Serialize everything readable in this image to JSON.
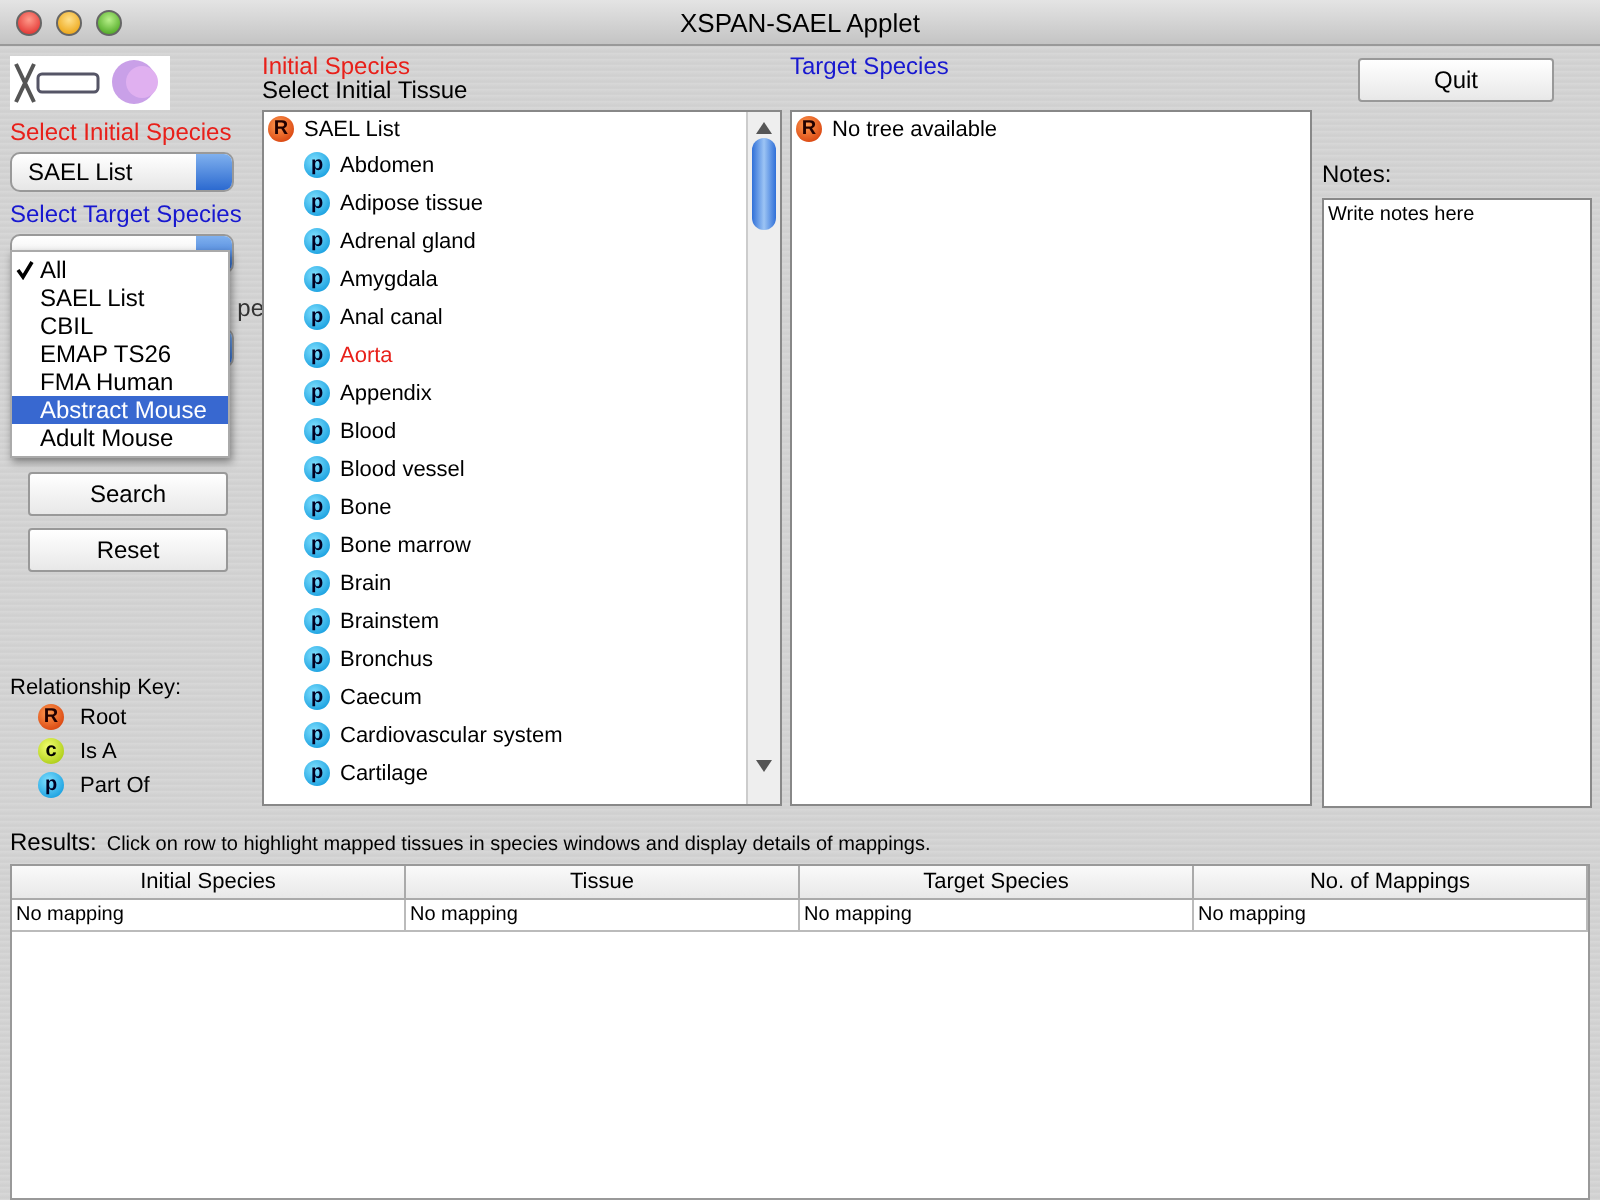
{
  "window": {
    "title": "XSPAN-SAEL Applet"
  },
  "left_panel": {
    "initial_label": "Select Initial Species",
    "initial_value": "SAEL List",
    "target_label": "Select Target Species",
    "mapping_label_fragment": "pe",
    "buttons": [
      "Search",
      "Reset"
    ],
    "key_title": "Relationship Key:",
    "key": [
      {
        "kind": "root",
        "glyph": "R",
        "label": "Root"
      },
      {
        "kind": "is_a",
        "glyph": "c",
        "label": "Is A"
      },
      {
        "kind": "part_of",
        "glyph": "p",
        "label": "Part Of"
      }
    ]
  },
  "target_menu": [
    {
      "label": "All",
      "checked": true,
      "selected": false
    },
    {
      "label": "SAEL List",
      "checked": false,
      "selected": false
    },
    {
      "label": "CBIL",
      "checked": false,
      "selected": false
    },
    {
      "label": "EMAP TS26",
      "checked": false,
      "selected": false
    },
    {
      "label": "FMA Human",
      "checked": false,
      "selected": false
    },
    {
      "label": "Abstract Mouse",
      "checked": false,
      "selected": true
    },
    {
      "label": "Adult Mouse",
      "checked": false,
      "selected": false
    }
  ],
  "initial_panel": {
    "title": "Initial Species",
    "subtitle": "Select Initial Tissue",
    "tree": [
      {
        "kind": "root",
        "glyph": "R",
        "label": "SAEL List",
        "highlighted": false,
        "children": [
          {
            "kind": "part_of",
            "glyph": "p",
            "label": "Abdomen",
            "highlighted": false
          },
          {
            "kind": "part_of",
            "glyph": "p",
            "label": "Adipose tissue",
            "highlighted": false
          },
          {
            "kind": "part_of",
            "glyph": "p",
            "label": "Adrenal gland",
            "highlighted": false
          },
          {
            "kind": "part_of",
            "glyph": "p",
            "label": "Amygdala",
            "highlighted": false
          },
          {
            "kind": "part_of",
            "glyph": "p",
            "label": "Anal canal",
            "highlighted": false
          },
          {
            "kind": "part_of",
            "glyph": "p",
            "label": "Aorta",
            "highlighted": true
          },
          {
            "kind": "part_of",
            "glyph": "p",
            "label": "Appendix",
            "highlighted": false
          },
          {
            "kind": "part_of",
            "glyph": "p",
            "label": "Blood",
            "highlighted": false
          },
          {
            "kind": "part_of",
            "glyph": "p",
            "label": "Blood vessel",
            "highlighted": false
          },
          {
            "kind": "part_of",
            "glyph": "p",
            "label": "Bone",
            "highlighted": false
          },
          {
            "kind": "part_of",
            "glyph": "p",
            "label": "Bone marrow",
            "highlighted": false
          },
          {
            "kind": "part_of",
            "glyph": "p",
            "label": "Brain",
            "highlighted": false
          },
          {
            "kind": "part_of",
            "glyph": "p",
            "label": "Brainstem",
            "highlighted": false
          },
          {
            "kind": "part_of",
            "glyph": "p",
            "label": "Bronchus",
            "highlighted": false
          },
          {
            "kind": "part_of",
            "glyph": "p",
            "label": "Caecum",
            "highlighted": false
          },
          {
            "kind": "part_of",
            "glyph": "p",
            "label": "Cardiovascular system",
            "highlighted": false
          },
          {
            "kind": "part_of",
            "glyph": "p",
            "label": "Cartilage",
            "highlighted": false
          }
        ]
      }
    ]
  },
  "target_panel": {
    "title": "Target Species",
    "tree": [
      {
        "kind": "root",
        "glyph": "R",
        "label": "No tree available",
        "highlighted": false
      }
    ]
  },
  "quit_button": "Quit",
  "notes": {
    "label": "Notes:",
    "value": "Write notes here"
  },
  "results": {
    "label": "Results:",
    "hint": "Click on row to highlight mapped tissues in species windows and display details of mappings.",
    "columns": [
      "Initial Species",
      "Tissue",
      "Target Species",
      "No. of Mappings"
    ],
    "rows": [
      [
        "No mapping",
        "No mapping",
        "No mapping",
        "No mapping"
      ]
    ]
  }
}
